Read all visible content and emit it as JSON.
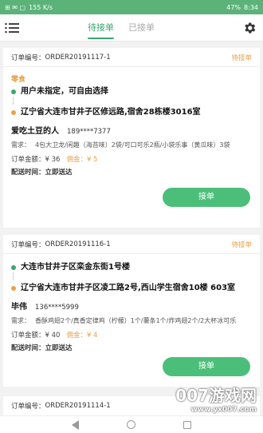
{
  "statusbar": {
    "left": "⊞ ✉ ▢",
    "net": "155 K/s",
    "battery": "47%",
    "time": "8:34"
  },
  "header": {
    "tabs": [
      {
        "label": "待接单",
        "active": true
      },
      {
        "label": "已接单",
        "active": false
      }
    ]
  },
  "orders": [
    {
      "order_label": "订单编号：",
      "order_no": "ORDER20191117-1",
      "status": "待接单",
      "tag": "零食",
      "from": "用户未指定，可自由选择",
      "to": "辽宁省大连市甘井子区修远路,宿舍28栋楼3016室",
      "name": "爱吃土豆的人",
      "phone": "189****7377",
      "needs_label": "需求：",
      "needs": "4包大卫龙/闲趣（海苔味）2袋/可口可乐2瓶/小袋乐事（黄瓜味）3袋",
      "amount_label": "订单金额：¥ 36",
      "commission": "佣金：¥ 5",
      "deliver": "配送时间：立即送达",
      "button": "接单"
    },
    {
      "order_label": "订单编号：",
      "order_no": "ORDER20191116-1",
      "status": "待接单",
      "tag": "",
      "from": "大连市甘井子区栾金东街1号楼",
      "to": "辽宁省大连市甘井子区凌工路2号,西山学生宿舍10楼 603室",
      "name": "毕伟",
      "phone": "136****5999",
      "needs_label": "需求：",
      "needs": "香酥鸡翅2个/真香定律鸡（柠檬）1个/薯条1个/炸鸡翅2个/2大杯冰可乐",
      "amount_label": "订单金额：¥ 40",
      "commission": "佣金：¥ 4",
      "deliver": "配送时间：立即送达",
      "button": "接单"
    },
    {
      "order_label": "订单编号：",
      "order_no": "ORDER20191114-1"
    }
  ],
  "watermark": {
    "big": "007游戏网",
    "small": "www.yx007.com"
  },
  "colors": {
    "primary": "#3aa76d",
    "accent": "#e9a14a",
    "button": "#4bbf7a"
  }
}
